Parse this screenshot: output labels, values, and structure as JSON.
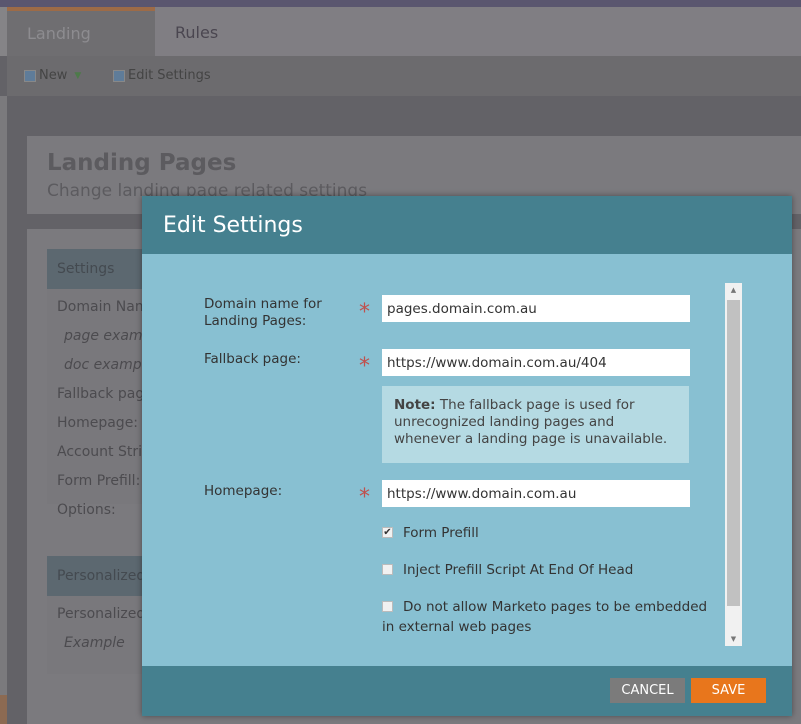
{
  "tabs": [
    {
      "label": "Landing Pages",
      "active": true
    },
    {
      "label": "Rules",
      "active": false
    }
  ],
  "toolbar": {
    "new_label": "New",
    "edit_label": "Edit Settings"
  },
  "page": {
    "title": "Landing Pages",
    "subtitle": "Change landing page related settings"
  },
  "settings": {
    "header": "Settings",
    "rows": [
      "Domain Name",
      "page example",
      "doc example",
      "Fallback page",
      "Homepage:",
      "Account String",
      "Form Prefill:",
      "Options:"
    ]
  },
  "personalized": {
    "header": "Personalized",
    "rows": [
      "Personalized",
      "Example"
    ]
  },
  "dialog": {
    "title": "Edit Settings",
    "domain_label": "Domain name for Landing Pages:",
    "domain_value": "pages.domain.com.au",
    "fallback_label": "Fallback page:",
    "fallback_value": "https://www.domain.com.au/404",
    "note_bold": "Note:",
    "note_text": " The fallback page is used for unrecognized landing pages and whenever a landing page is unavailable.",
    "homepage_label": "Homepage:",
    "homepage_value": "https://www.domain.com.au",
    "checkboxes": [
      {
        "label": "Form Prefill",
        "checked": true
      },
      {
        "label": "Inject Prefill Script At End Of Head",
        "checked": false
      },
      {
        "label": "Do not allow Marketo pages to be embedded in external web pages",
        "checked": false
      }
    ],
    "cancel_label": "CANCEL",
    "save_label": "SAVE"
  },
  "colors": {
    "dialog_header": "#45808f",
    "dialog_body": "#88c0d2",
    "save": "#e8761c",
    "required": "#c0504d"
  }
}
